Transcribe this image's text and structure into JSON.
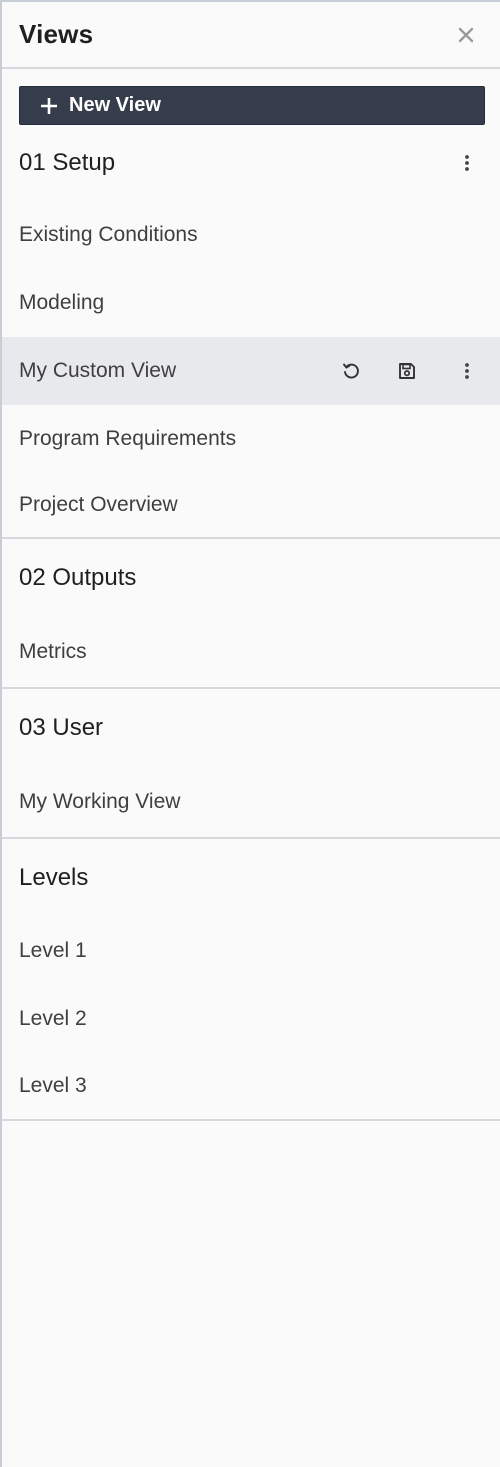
{
  "panel": {
    "title": "Views",
    "close_icon": "close-icon"
  },
  "new_view_button": {
    "label": "New View",
    "icon": "plus-icon"
  },
  "groups": [
    {
      "title": "01 Setup",
      "menu_icon": "more-vertical-icon",
      "items": [
        {
          "label": "Existing Conditions"
        },
        {
          "label": "Modeling"
        },
        {
          "label": "My Custom View",
          "selected": true,
          "actions": [
            "reset-icon",
            "save-icon",
            "more-vertical-icon"
          ]
        },
        {
          "label": "Program Requirements"
        },
        {
          "label": "Project Overview"
        }
      ]
    },
    {
      "title": "02 Outputs",
      "items": [
        {
          "label": "Metrics"
        }
      ]
    },
    {
      "title": "03 User",
      "items": [
        {
          "label": "My Working View"
        }
      ]
    },
    {
      "title": "Levels",
      "items": [
        {
          "label": "Level 1"
        },
        {
          "label": "Level 2"
        },
        {
          "label": "Level 3"
        }
      ]
    }
  ],
  "colors": {
    "button_bg": "#353d4c",
    "selected_bg": "#e8e9ec",
    "divider": "#d6d8dc"
  }
}
